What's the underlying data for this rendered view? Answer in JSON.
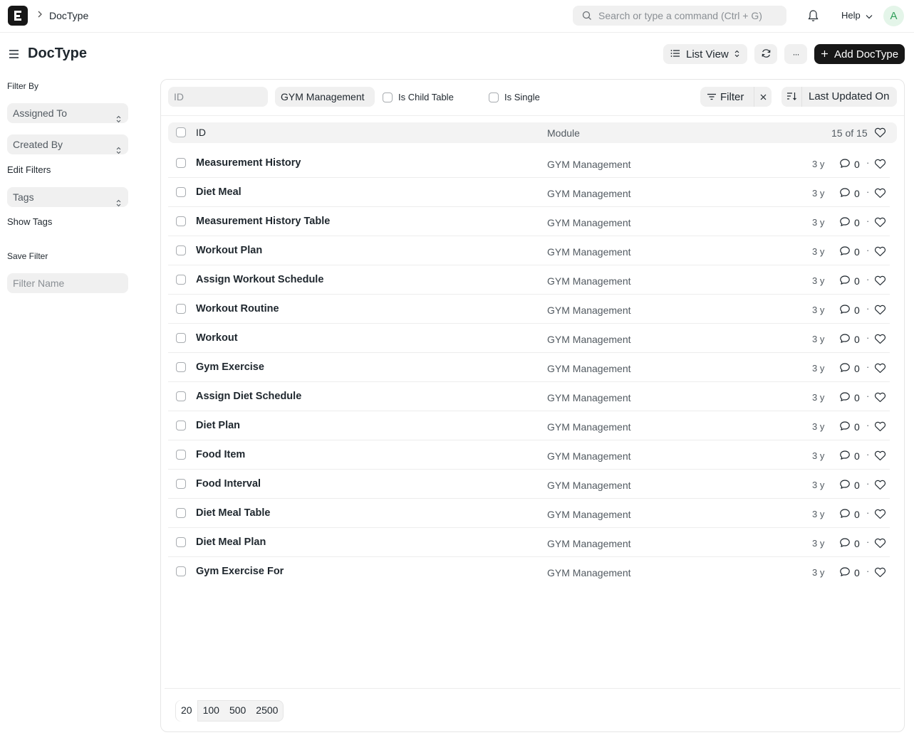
{
  "navbar": {
    "breadcrumb": "DocType",
    "search_placeholder": "Search or type a command (Ctrl + G)",
    "help_label": "Help",
    "avatar_initial": "A"
  },
  "page": {
    "title": "DocType",
    "list_view_label": "List View",
    "add_button_label": "Add DocType",
    "more_label": "···"
  },
  "sidebar": {
    "filter_by": "Filter By",
    "assigned_to": "Assigned To",
    "created_by": "Created By",
    "edit_filters": "Edit Filters",
    "tags": "Tags",
    "show_tags": "Show Tags",
    "save_filter": "Save Filter",
    "filter_name_placeholder": "Filter Name"
  },
  "filters": {
    "id_placeholder": "ID",
    "module_value": "GYM Management",
    "is_child_table": "Is Child Table",
    "is_single": "Is Single",
    "filter_label": "Filter",
    "sort_label": "Last Updated On"
  },
  "list": {
    "col_id": "ID",
    "col_module": "Module",
    "count": "15 of 15",
    "rows": [
      {
        "name": "Measurement History",
        "module": "GYM Management",
        "time": "3 y",
        "comments": "0"
      },
      {
        "name": "Diet Meal",
        "module": "GYM Management",
        "time": "3 y",
        "comments": "0"
      },
      {
        "name": "Measurement History Table",
        "module": "GYM Management",
        "time": "3 y",
        "comments": "0"
      },
      {
        "name": "Workout Plan",
        "module": "GYM Management",
        "time": "3 y",
        "comments": "0"
      },
      {
        "name": "Assign Workout Schedule",
        "module": "GYM Management",
        "time": "3 y",
        "comments": "0"
      },
      {
        "name": "Workout Routine",
        "module": "GYM Management",
        "time": "3 y",
        "comments": "0"
      },
      {
        "name": "Workout",
        "module": "GYM Management",
        "time": "3 y",
        "comments": "0"
      },
      {
        "name": "Gym Exercise",
        "module": "GYM Management",
        "time": "3 y",
        "comments": "0"
      },
      {
        "name": "Assign Diet Schedule",
        "module": "GYM Management",
        "time": "3 y",
        "comments": "0"
      },
      {
        "name": "Diet Plan",
        "module": "GYM Management",
        "time": "3 y",
        "comments": "0"
      },
      {
        "name": "Food Item",
        "module": "GYM Management",
        "time": "3 y",
        "comments": "0"
      },
      {
        "name": "Food Interval",
        "module": "GYM Management",
        "time": "3 y",
        "comments": "0"
      },
      {
        "name": "Diet Meal Table",
        "module": "GYM Management",
        "time": "3 y",
        "comments": "0"
      },
      {
        "name": "Diet Meal Plan",
        "module": "GYM Management",
        "time": "3 y",
        "comments": "0"
      },
      {
        "name": "Gym Exercise For",
        "module": "GYM Management",
        "time": "3 y",
        "comments": "0"
      }
    ]
  },
  "paging": {
    "sizes": [
      "20",
      "100",
      "500",
      "2500"
    ],
    "selected": "20"
  }
}
